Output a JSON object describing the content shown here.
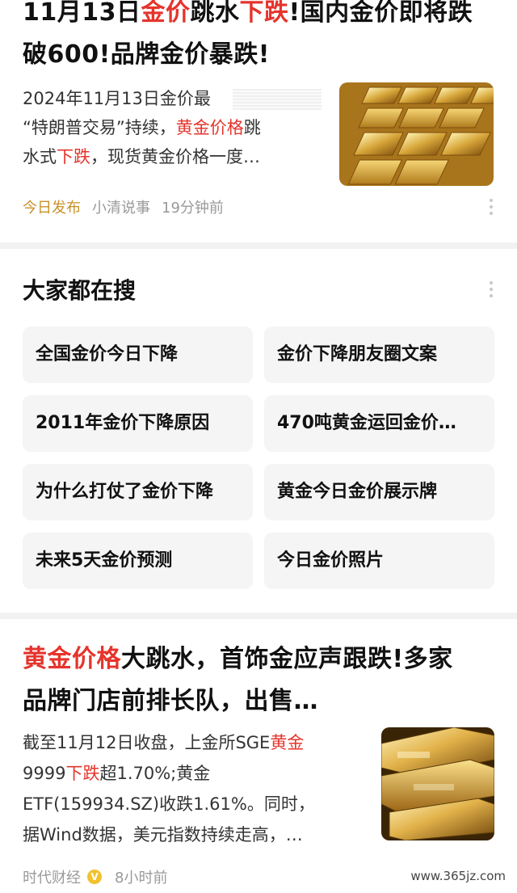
{
  "article1": {
    "title_line1": "11月13日金价跳水下跌!国内金价即将跌",
    "title_line1_parts": [
      "11月13日",
      "金价",
      "跳水",
      "下跌",
      "!国内金价即将跌"
    ],
    "title_line2": "破600!品牌金价暴跌!",
    "summary_line1": "2024年11月13日金价最",
    "summary_line2_parts": [
      "“特朗普交易”持续，",
      "黄金价格",
      "跳"
    ],
    "summary_line3_parts": [
      "水式",
      "下跌",
      "，现货黄金价格一度…"
    ],
    "tag": "今日发布",
    "source": "小清说事",
    "time": "19分钟前",
    "thumb_icon": "gold-bars-image"
  },
  "search": {
    "title": "大家都在搜",
    "items": [
      "全国金价今日下降",
      "金价下降朋友圈文案",
      "2011年金价下降原因",
      "470吨黄金运回金价…",
      "为什么打仗了金价下降",
      "黄金今日金价展示牌",
      "未来5天金价预测",
      "今日金价照片"
    ]
  },
  "article2": {
    "title_line1_parts": [
      "黄金价格",
      "大跳水，首饰金应声跟跌!多家"
    ],
    "title_line2": "品牌门店前排长队，出售…",
    "summary_line1_parts": [
      "截至11月12日收盘，上金所SGE",
      "黄金"
    ],
    "summary_line2_parts": [
      "9999",
      "下跌",
      "超1.70%;黄金"
    ],
    "summary_line3": "ETF(159934.SZ)收跌1.61%。同时，",
    "summary_line4": "据Wind数据，美元指数持续走高，…",
    "source": "时代财经",
    "verified": "V",
    "time": "8小时前",
    "thumb_icon": "gold-bars-image"
  },
  "watermark": "www.365jz.com",
  "colors": {
    "highlight": "#e5342c",
    "tag": "#c9902a",
    "meta": "#9a9a9a",
    "chip_bg": "#f5f5f5",
    "divider": "#f2f2f2"
  }
}
